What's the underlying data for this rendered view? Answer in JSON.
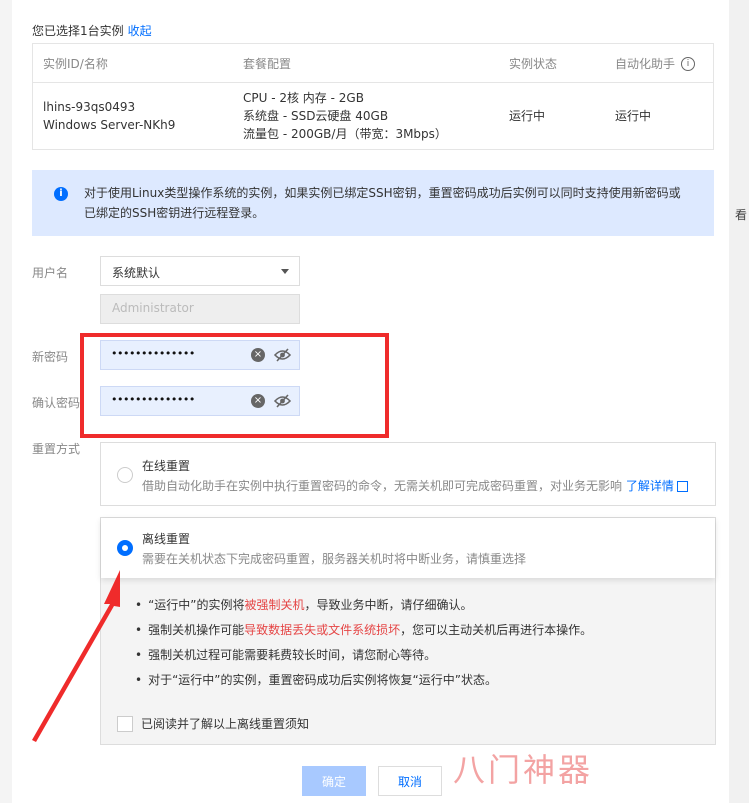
{
  "selection": {
    "text": "您已选择1台实例",
    "collapse": "收起"
  },
  "table": {
    "headers": [
      "实例ID/名称",
      "套餐配置",
      "实例状态",
      "自动化助手"
    ],
    "row": {
      "id": "lhins-93qs0493",
      "name": "Windows Server-NKh9",
      "config": [
        "CPU - 2核 内存 - 2GB",
        "系统盘 - SSD云硬盘 40GB",
        "流量包 - 200GB/月（带宽：3Mbps）"
      ],
      "status": "运行中",
      "assistant": "运行中"
    }
  },
  "notice": "对于使用Linux类型操作系统的实例，如果实例已绑定SSH密钥，重置密码成功后实例可以同时支持使用新密码或已绑定的SSH密钥进行远程登录。",
  "form": {
    "username_label": "用户名",
    "username_select": "系统默认",
    "username_placeholder": "Administrator",
    "new_password_label": "新密码",
    "new_password_dots": "••••••••••••••",
    "confirm_password_label": "确认密码",
    "confirm_password_dots": "••••••••••••••",
    "reset_mode_label": "重置方式"
  },
  "online": {
    "title": "在线重置",
    "desc": "借助自动化助手在实例中执行重置密码的命令，无需关机即可完成密码重置，对业务无影响",
    "link": "了解详情"
  },
  "offline": {
    "title": "离线重置",
    "desc": "需要在关机状态下完成密码重置，服务器关机时将中断业务，请慎重选择",
    "bullets": [
      {
        "a": "“运行中”的实例将",
        "b": "被强制关机",
        "c": "，导致业务中断，请仔细确认。"
      },
      {
        "a": "强制关机操作可能",
        "b": "导致数据丢失或文件系统损坏",
        "c": "，您可以主动关机后再进行本操作。"
      },
      {
        "a": "强制关机过程可能需要耗费较长时间，请您耐心等待。",
        "b": "",
        "c": ""
      },
      {
        "a": "对于“运行中”的实例，重置密码成功后实例将恢复“运行中”状态。",
        "b": "",
        "c": ""
      }
    ],
    "ack": "已阅读并了解以上离线重置须知"
  },
  "buttons": {
    "ok": "确定",
    "cancel": "取消"
  },
  "watermark": "八门神器",
  "edge_fragments": {
    "top_left": "您",
    "right_1": "看",
    "right_2": "ɪ"
  },
  "colors": {
    "primary": "#006eff",
    "success": "#0abf5b",
    "danger": "#e54545",
    "annotation": "#ef2b2b"
  }
}
